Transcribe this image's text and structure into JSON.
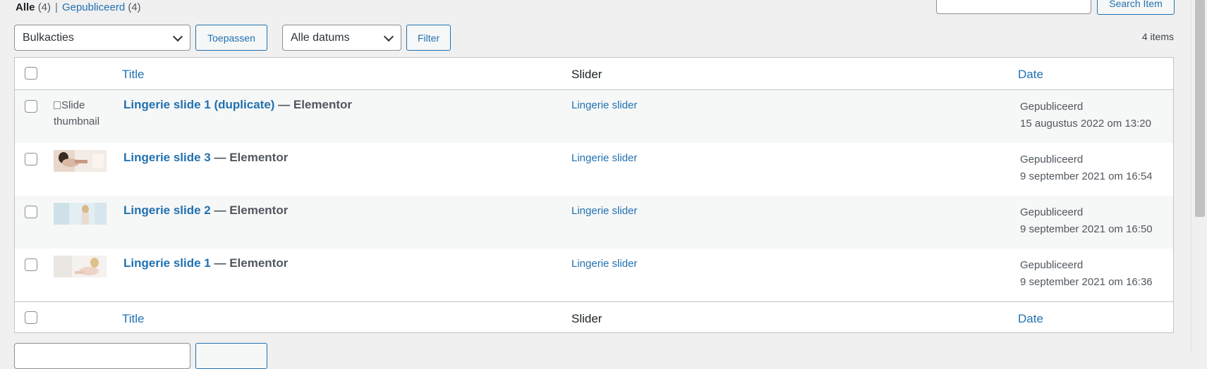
{
  "status_links": {
    "all_label": "Alle",
    "all_count": "(4)",
    "separator": "|",
    "published_label": "Gepubliceerd",
    "published_count": "(4)"
  },
  "search": {
    "value": "",
    "button_label": "Search Item"
  },
  "tablenav_top": {
    "bulk_actions_selected": "Bulkacties",
    "apply_label": "Toepassen",
    "dates_selected": "Alle datums",
    "filter_label": "Filter",
    "items_count": "4 items"
  },
  "table": {
    "headers": {
      "title": "Title",
      "slider": "Slider",
      "date": "Date"
    },
    "rows": [
      {
        "thumbnail_alt": "Slide thumbnail",
        "title": "Lingerie slide 1 (duplicate)",
        "post_state": " — Elementor",
        "slider": "Lingerie slider",
        "status": "Gepubliceerd",
        "date": "15 augustus 2022 om 13:20"
      },
      {
        "title": "Lingerie slide 3",
        "post_state": " — Elementor",
        "slider": "Lingerie slider",
        "status": "Gepubliceerd",
        "date": "9 september 2021 om 16:54"
      },
      {
        "title": "Lingerie slide 2",
        "post_state": " — Elementor",
        "slider": "Lingerie slider",
        "status": "Gepubliceerd",
        "date": "9 september 2021 om 16:50"
      },
      {
        "title": "Lingerie slide 1",
        "post_state": " — Elementor",
        "slider": "Lingerie slider",
        "status": "Gepubliceerd",
        "date": "9 september 2021 om 16:36"
      }
    ],
    "footer": {
      "title": "Title",
      "slider": "Slider",
      "date": "Date"
    }
  },
  "colors": {
    "link": "#2271b1",
    "background": "#f0f0f1",
    "row_alt": "#f6f7f7"
  }
}
